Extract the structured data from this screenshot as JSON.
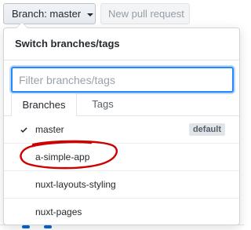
{
  "toolbar": {
    "branch_button_label": "Branch: master",
    "new_pr_label": "New pull request"
  },
  "dropdown": {
    "header_title": "Switch branches/tags",
    "filter_placeholder": "Filter branches/tags",
    "tabs": [
      {
        "label": "Branches",
        "active": true
      },
      {
        "label": "Tags",
        "active": false
      }
    ],
    "branches": [
      {
        "name": "master",
        "checked": true,
        "badge": "default"
      },
      {
        "name": "a-simple-app",
        "checked": false
      },
      {
        "name": "nuxt-layouts-styling",
        "checked": false
      },
      {
        "name": "nuxt-pages",
        "checked": false
      }
    ]
  },
  "colors": {
    "accent_blue": "#2188ff",
    "annotation_red": "#d10000",
    "badge_bg": "#e1e4e8"
  }
}
